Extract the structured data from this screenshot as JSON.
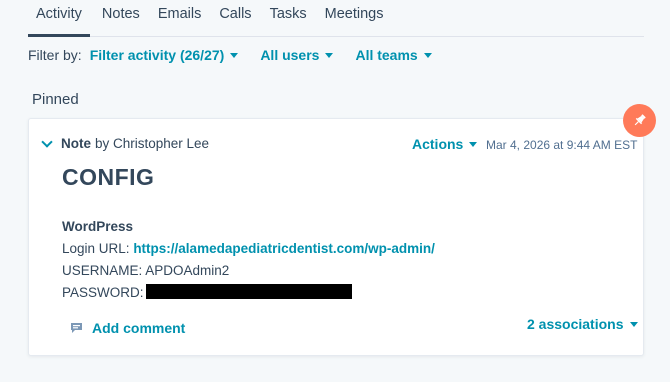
{
  "tabs": [
    {
      "label": "Activity",
      "active": true
    },
    {
      "label": "Notes"
    },
    {
      "label": "Emails"
    },
    {
      "label": "Calls"
    },
    {
      "label": "Tasks"
    },
    {
      "label": "Meetings"
    }
  ],
  "filter": {
    "label": "Filter by:",
    "activity": "Filter activity (26/27)",
    "users": "All users",
    "teams": "All teams"
  },
  "pinned_heading": "Pinned",
  "note": {
    "type": "Note",
    "by": "by Christopher Lee",
    "actions": "Actions",
    "timestamp": "Mar 4, 2026 at 9:44 AM EST",
    "title": "CONFIG",
    "section": "WordPress",
    "login_label": "Login URL:",
    "login_url": "https://alamedapediatricdentist.com/wp-admin/",
    "username_line": "USERNAME: APDOAdmin2",
    "password_label": "PASSWORD:",
    "add_comment": "Add comment",
    "associations": "2 associations"
  },
  "colors": {
    "accent": "#0091ae",
    "text": "#33475b",
    "pin": "#ff7a59",
    "background": "#f5f8fa"
  },
  "icons": [
    "pin-icon",
    "chevron-down-icon",
    "comment-icon",
    "caret-down-icon"
  ]
}
